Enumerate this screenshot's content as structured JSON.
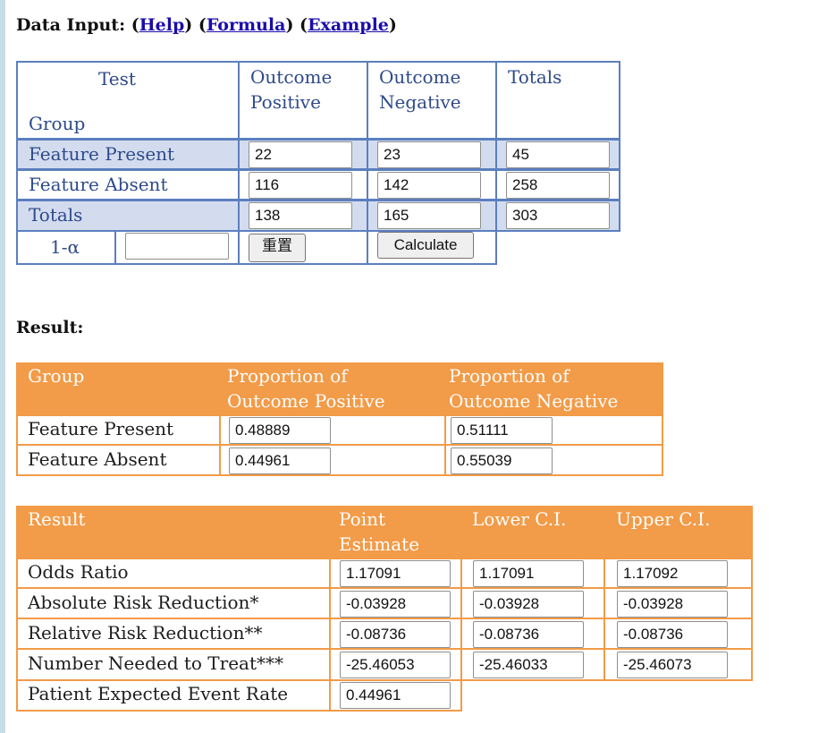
{
  "header": {
    "title": "Data Input:",
    "links": [
      "Help",
      "Formula",
      "Example"
    ]
  },
  "input_table": {
    "corner_top": "Test",
    "corner_bottom": "Group",
    "col_headers": [
      "Outcome Positive",
      "Outcome Negative",
      "Totals"
    ],
    "col_header_lines": [
      [
        "Outcome",
        "Positive"
      ],
      [
        "Outcome",
        "Negative"
      ],
      [
        "Totals"
      ]
    ],
    "rows": [
      {
        "label": "Feature Present",
        "values": [
          "22",
          "23",
          "45"
        ]
      },
      {
        "label": "Feature Absent",
        "values": [
          "116",
          "142",
          "258"
        ]
      },
      {
        "label": "Totals",
        "values": [
          "138",
          "165",
          "303"
        ]
      }
    ],
    "alpha_label": "1-α",
    "alpha_value": "",
    "reset_label": "重置",
    "calculate_label": "Calculate"
  },
  "result_heading": "Result:",
  "proportion_table": {
    "headers": [
      "Group",
      "Proportion of Outcome Positive",
      "Proportion of Outcome Negative"
    ],
    "header_lines": [
      [
        "Group"
      ],
      [
        "Proportion of",
        "Outcome Positive"
      ],
      [
        "Proportion of",
        "Outcome Negative"
      ]
    ],
    "rows": [
      {
        "label": "Feature Present",
        "values": [
          "0.48889",
          "0.51111"
        ]
      },
      {
        "label": "Feature Absent",
        "values": [
          "0.44961",
          "0.55039"
        ]
      }
    ]
  },
  "result_table": {
    "headers": [
      "Result",
      "Point Estimate",
      "Lower C.I.",
      "Upper C.I."
    ],
    "header_lines": [
      [
        "Result"
      ],
      [
        "Point",
        "Estimate"
      ],
      [
        "Lower C.I."
      ],
      [
        "Upper C.I."
      ]
    ],
    "rows": [
      {
        "label": "Odds Ratio",
        "values": [
          "1.17091",
          "1.17091",
          "1.17092"
        ]
      },
      {
        "label": "Absolute Risk Reduction*",
        "values": [
          "-0.03928",
          "-0.03928",
          "-0.03928"
        ]
      },
      {
        "label": "Relative Risk Reduction**",
        "values": [
          "-0.08736",
          "-0.08736",
          "-0.08736"
        ]
      },
      {
        "label": "Number Needed to Treat***",
        "values": [
          "-25.46053",
          "-25.46033",
          "-25.46073"
        ]
      },
      {
        "label": "Patient Expected Event Rate",
        "values": [
          "0.44961"
        ]
      }
    ]
  },
  "colors": {
    "blue_border": "#5b7fbf",
    "blue_fill": "#d3dcef",
    "orange": "#f29b48",
    "link": "#1a0dab"
  }
}
